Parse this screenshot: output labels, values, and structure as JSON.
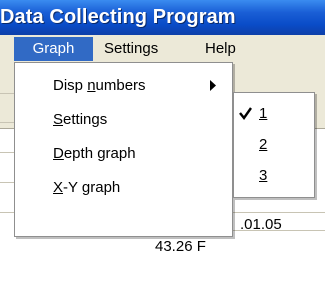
{
  "window": {
    "title": "Data Collecting Program"
  },
  "menubar": {
    "items": [
      {
        "label": "Graph",
        "active": true
      },
      {
        "label": "Settings"
      },
      {
        "label": "Help"
      }
    ]
  },
  "graph_menu": {
    "items": [
      {
        "label_pre": "Disp ",
        "label_mnemonic": "n",
        "label_post": "umbers",
        "has_submenu": true
      },
      {
        "label_pre": "",
        "label_mnemonic": "S",
        "label_post": "ettings"
      },
      {
        "label_pre": "",
        "label_mnemonic": "D",
        "label_post": "epth graph"
      },
      {
        "label_pre": "",
        "label_mnemonic": "X",
        "label_post": "-Y graph"
      }
    ]
  },
  "disp_numbers_submenu": {
    "items": [
      {
        "label": "1",
        "checked": true
      },
      {
        "label": "2",
        "checked": false
      },
      {
        "label": "3",
        "checked": false
      }
    ]
  },
  "background": {
    "partial_values": [
      ".01.05",
      "43.26 F"
    ]
  },
  "colors": {
    "title_bar": "#0a4cc8",
    "menu_highlight": "#316ac5",
    "menu_bg": "#ece9d8"
  }
}
